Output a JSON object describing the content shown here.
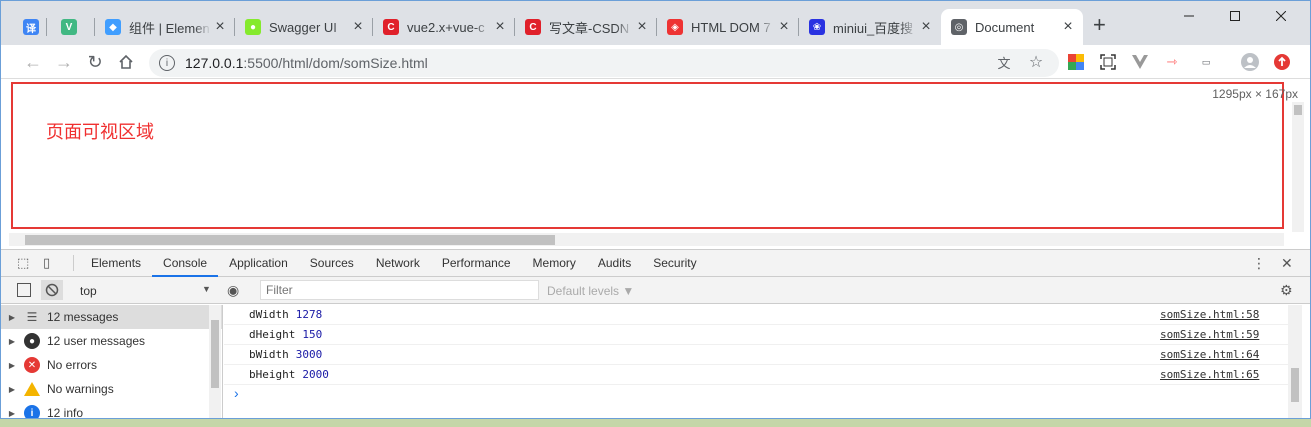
{
  "tabs": [
    {
      "label": "",
      "icon": "translate-icon",
      "icon_char": "译",
      "color": "#3f85f4"
    },
    {
      "label": "",
      "icon": "vue-icon",
      "icon_char": "V",
      "color": "#41b883"
    },
    {
      "label": "组件 | Elemen",
      "icon": "element-icon",
      "icon_char": "◆",
      "color": "#409eff"
    },
    {
      "label": "Swagger UI",
      "icon": "swagger-icon",
      "icon_char": "●",
      "color": "#85ea2d"
    },
    {
      "label": "vue2.x+vue-c",
      "icon": "csdn-icon",
      "icon_char": "C",
      "color": "#e0202a"
    },
    {
      "label": "写文章-CSDN",
      "icon": "csdn-icon",
      "icon_char": "C",
      "color": "#e0202a"
    },
    {
      "label": "HTML DOM 7",
      "icon": "runoob-icon",
      "icon_char": "◈",
      "color": "#e33"
    },
    {
      "label": "miniui_百度搜",
      "icon": "baidu-icon",
      "icon_char": "❀",
      "color": "#2932e1"
    },
    {
      "label": "Document",
      "icon": "globe-icon",
      "icon_char": "◎",
      "color": "#5f6368"
    }
  ],
  "address": {
    "host": "127.0.0.1",
    "path": ":5500/html/dom/somSize.html"
  },
  "page": {
    "heading": "页面可视区域",
    "dimensions": "1295px × 167px"
  },
  "devtools": {
    "tabs": [
      "Elements",
      "Console",
      "Application",
      "Sources",
      "Network",
      "Performance",
      "Memory",
      "Audits",
      "Security"
    ],
    "active_tab": "Console",
    "context": "top",
    "filter_placeholder": "Filter",
    "levels": "Default levels ▼",
    "sidebar": [
      {
        "label": "12 messages",
        "icon": "list-icon",
        "icon_char": "☰",
        "color": "#555"
      },
      {
        "label": "12 user messages",
        "icon": "user-icon",
        "icon_char": "●",
        "color": "#333"
      },
      {
        "label": "No errors",
        "icon": "error-icon",
        "icon_char": "✕",
        "color": "#e53935"
      },
      {
        "label": "No warnings",
        "icon": "warning-icon",
        "icon_char": "!",
        "color": "#f4b400"
      },
      {
        "label": "12 info",
        "icon": "info-icon",
        "icon_char": "i",
        "color": "#1a73e8"
      }
    ],
    "logs": [
      {
        "key": "dWidth",
        "value": "1278",
        "source": "somSize.html:58"
      },
      {
        "key": "dHeight",
        "value": "150",
        "source": "somSize.html:59"
      },
      {
        "key": "bWidth",
        "value": "3000",
        "source": "somSize.html:64"
      },
      {
        "key": "bHeight",
        "value": "2000",
        "source": "somSize.html:65"
      }
    ],
    "prompt": "›"
  }
}
